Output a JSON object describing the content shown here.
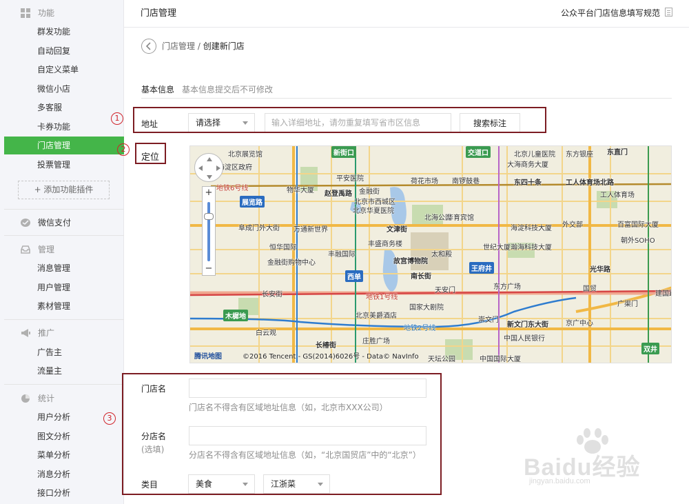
{
  "sidebar": {
    "sections": [
      {
        "icon": "grid-icon",
        "title": "功能",
        "items": [
          "群发功能",
          "自动回复",
          "自定义菜单",
          "微信小店",
          "多客服",
          "卡券功能",
          "门店管理",
          "投票管理"
        ]
      },
      {
        "icon": "wallet-icon",
        "title": "微信支付",
        "items": []
      },
      {
        "icon": "tray-icon",
        "title": "管理",
        "items": [
          "消息管理",
          "用户管理",
          "素材管理"
        ]
      },
      {
        "icon": "megaphone-icon",
        "title": "推广",
        "items": [
          "广告主",
          "流量主"
        ]
      },
      {
        "icon": "pie-chart-icon",
        "title": "统计",
        "items": [
          "用户分析",
          "图文分析",
          "菜单分析",
          "消息分析",
          "接口分析"
        ]
      }
    ],
    "active_item": "门店管理",
    "add_plugin": "+ 添加功能插件"
  },
  "header": {
    "title": "门店管理",
    "guide_link": "公众平台门店信息填写规范"
  },
  "breadcrumb": {
    "parent": "门店管理",
    "separator": " / ",
    "current": "创建新门店"
  },
  "basic_info": {
    "title": "基本信息",
    "tip": "基本信息提交后不可修改"
  },
  "address": {
    "label": "地址",
    "region_select": "请选择",
    "detail_placeholder": "输入详细地址，请勿重复填写省市区信息",
    "search_button": "搜索标注"
  },
  "location": {
    "label": "定位"
  },
  "map": {
    "logo": "腾讯地图",
    "copyright": "©2016 Tencent - GS(2014)6026号 - Data© NavInfo",
    "labels": {
      "l1": "北京展览馆",
      "l2": "新街口",
      "l3": "交道口",
      "l4": "北京儿童医院",
      "l5": "东方银座",
      "l6": "东直门",
      "l7": "海淀区政府",
      "l8": "平安医院",
      "l9": "荷花市场",
      "l10": "南锣鼓巷",
      "l11": "大海商务大厦",
      "l12": "东四十条",
      "l13": "工人体育场北路",
      "l14": "地铁6号线",
      "l15": "物华大厦",
      "l16": "金融街",
      "l17": "赵登禹路",
      "l18": "北京市西城区",
      "l19": "北京华夏医院",
      "l20": "展览路",
      "l21": "北海公园",
      "l22": "华育宾馆",
      "l23": "工人体育场",
      "l24": "阜成门外大街",
      "l25": "万通新世界",
      "l26": "文津街",
      "l27": "海淀科技大厦",
      "l28": "外交部",
      "l29": "百富国际大厦",
      "l30": "恒华国际",
      "l31": "丰盛商务楼",
      "l32": "世纪大厦",
      "l33": "瀚海科技大厦",
      "l34": "朝外SOHO",
      "l35": "丰融国际",
      "l36": "故宫博物院",
      "l37": "太和殿",
      "l38": "王府井",
      "l39": "光华路",
      "l40": "金融街购物中心",
      "l41": "西单",
      "l42": "东方广场",
      "l43": "长安街",
      "l44": "天安门",
      "l45": "国贸",
      "l46": "地铁1号线",
      "l47": "国家大剧院",
      "l48": "木樨地",
      "l49": "北京美爵酒店",
      "l50": "地铁2号线",
      "l51": "新文门东大街",
      "l52": "崇文门",
      "l53": "中国人民银行",
      "l54": "京广中心",
      "l55": "建国路",
      "l56": "白云观",
      "l57": "庄胜广场",
      "l58": "长椿街",
      "l59": "南长街",
      "l60": "天坛公园",
      "l61": "双井",
      "l62": "广渠门",
      "l63": "中国国际大厦"
    }
  },
  "store_form": {
    "name_label": "门店名",
    "name_help": "门店名不得含有区域地址信息（如，北京市XXX公司）",
    "branch_label": "分店名",
    "branch_sub": "(选填)",
    "branch_help": "分店名不得含有区域地址信息（如，“北京国贸店”中的“北京”）",
    "category_label": "类目",
    "category_primary": "美食",
    "category_secondary": "江浙菜"
  },
  "annotations": [
    "1",
    "2",
    "3"
  ],
  "watermark": {
    "text": "Baidu经验",
    "url": "jingyan.baidu.com"
  },
  "colors": {
    "accent": "#44b549",
    "annotation": "#7c1c22",
    "annotation_number": "#d0232a"
  }
}
